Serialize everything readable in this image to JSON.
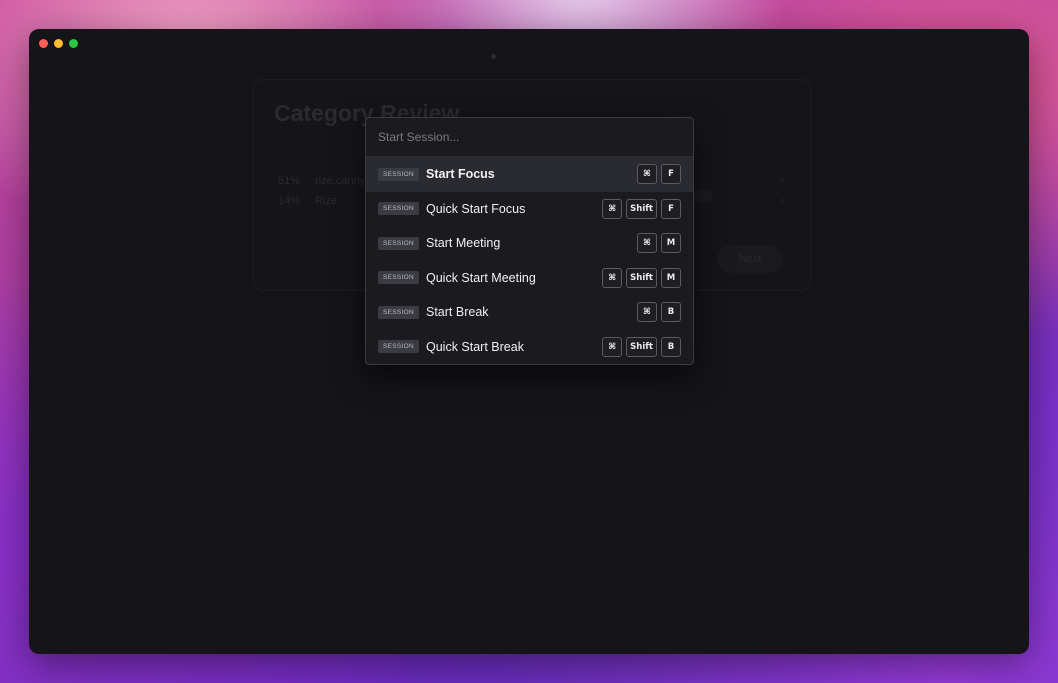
{
  "window": {
    "background_card": {
      "title": "Category Review",
      "rows": [
        {
          "percent": "51%",
          "name": "rize.canny.io"
        },
        {
          "percent": "14%",
          "name": "Rize"
        }
      ],
      "chevron": "‹",
      "next_label": "Next"
    }
  },
  "palette": {
    "placeholder": "Start Session...",
    "items": [
      {
        "badge": "SESSION",
        "label": "Start Focus",
        "keys": [
          "⌘",
          "F"
        ]
      },
      {
        "badge": "SESSION",
        "label": "Quick Start Focus",
        "keys": [
          "⌘",
          "Shift",
          "F"
        ]
      },
      {
        "badge": "SESSION",
        "label": "Start Meeting",
        "keys": [
          "⌘",
          "M"
        ]
      },
      {
        "badge": "SESSION",
        "label": "Quick Start Meeting",
        "keys": [
          "⌘",
          "Shift",
          "M"
        ]
      },
      {
        "badge": "SESSION",
        "label": "Start Break",
        "keys": [
          "⌘",
          "B"
        ]
      },
      {
        "badge": "SESSION",
        "label": "Quick Start Break",
        "keys": [
          "⌘",
          "Shift",
          "B"
        ]
      }
    ]
  },
  "colors": {
    "window_bg": "#141419",
    "palette_bg": "#1a1a1f",
    "active_row": "#2a2a31",
    "traffic_red": "#ff5f57",
    "traffic_yellow": "#febc2e",
    "traffic_green": "#28c840"
  }
}
